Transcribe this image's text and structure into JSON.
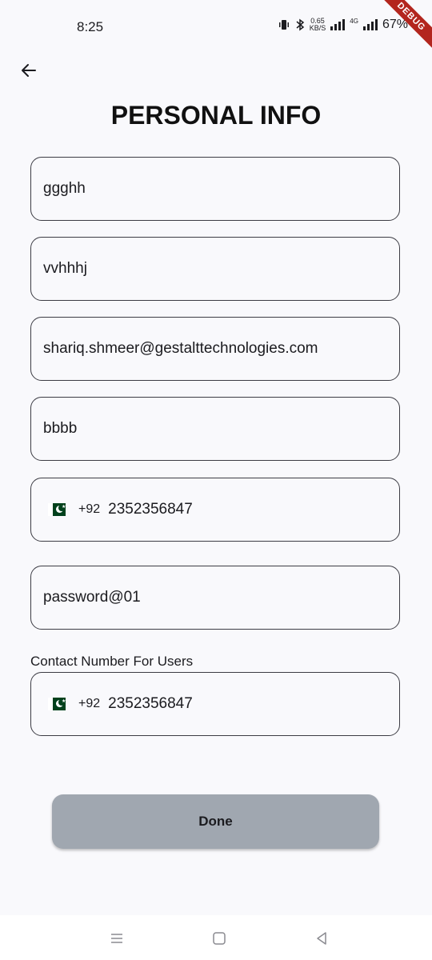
{
  "status_bar": {
    "time": "8:25",
    "net_speed_value": "0.65",
    "net_speed_unit": "KB/S",
    "network_type": "4G",
    "battery": "67%"
  },
  "debug_banner": "DEBUG",
  "header": {
    "title": "PERSONAL INFO"
  },
  "form": {
    "first_name_value": "ggghh",
    "last_name_value": "vvhhhj",
    "email_value": "shariq.shmeer@gestalttechnologies.com",
    "company_value": "bbbb",
    "phone": {
      "dial_code": "+92",
      "number": "2352356847"
    },
    "password_value": "password@01",
    "contact_label": "Contact Number For Users",
    "contact_phone": {
      "dial_code": "+92",
      "number": "2352356847"
    }
  },
  "actions": {
    "done_label": "Done"
  },
  "colors": {
    "background": "#f9f9fc",
    "button": "#a0a7b0",
    "border": "#3c3c44",
    "flag_green": "#01411c"
  }
}
